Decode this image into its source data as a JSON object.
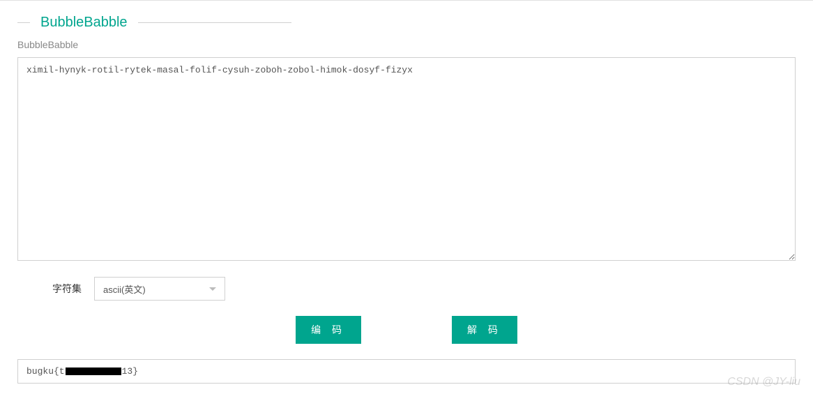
{
  "header": {
    "title": "BubbleBabble",
    "subtitle": "BubbleBabble"
  },
  "input": {
    "value": "ximil-hynyk-rotil-rytek-masal-folif-cysuh-zoboh-zobol-himok-dosyf-fizyx"
  },
  "charset": {
    "label": "字符集",
    "selected": "ascii(英文)"
  },
  "buttons": {
    "encode": "编 码",
    "decode": "解 码"
  },
  "output": {
    "prefix": "bugku{t",
    "suffix": "13}"
  },
  "watermark": "CSDN @JY-liu"
}
